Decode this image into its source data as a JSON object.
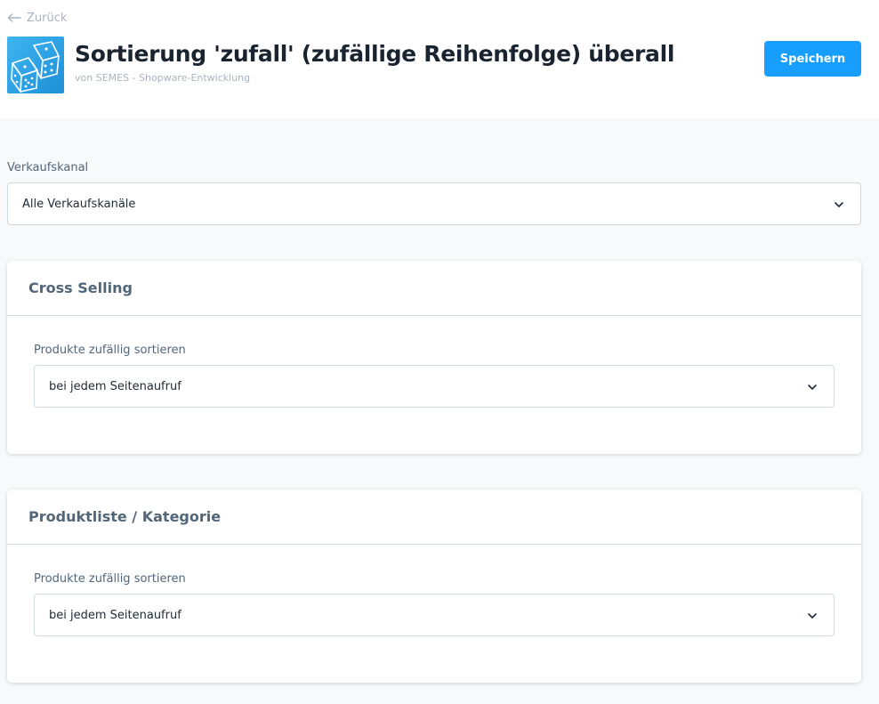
{
  "header": {
    "back_label": "Zurück",
    "title": "Sortierung 'zufall' (zufällige Reihenfolge) überall",
    "author": "von SEMES - Shopware-Entwicklung",
    "save_label": "Speichern",
    "icon": "dice-icon"
  },
  "sales_channel": {
    "label": "Verkaufskanal",
    "value": "Alle Verkaufskanäle"
  },
  "cards": [
    {
      "title": "Cross Selling",
      "field_label": "Produkte zufällig sortieren",
      "field_value": "bei jedem Seitenaufruf"
    },
    {
      "title": "Produktliste / Kategorie",
      "field_label": "Produkte zufällig sortieren",
      "field_value": "bei jedem Seitenaufruf"
    }
  ],
  "colors": {
    "primary": "#189eff",
    "label": "#52667a",
    "muted": "#a9b4c0",
    "border": "#d1d9e0",
    "background": "#f7f9fb"
  }
}
